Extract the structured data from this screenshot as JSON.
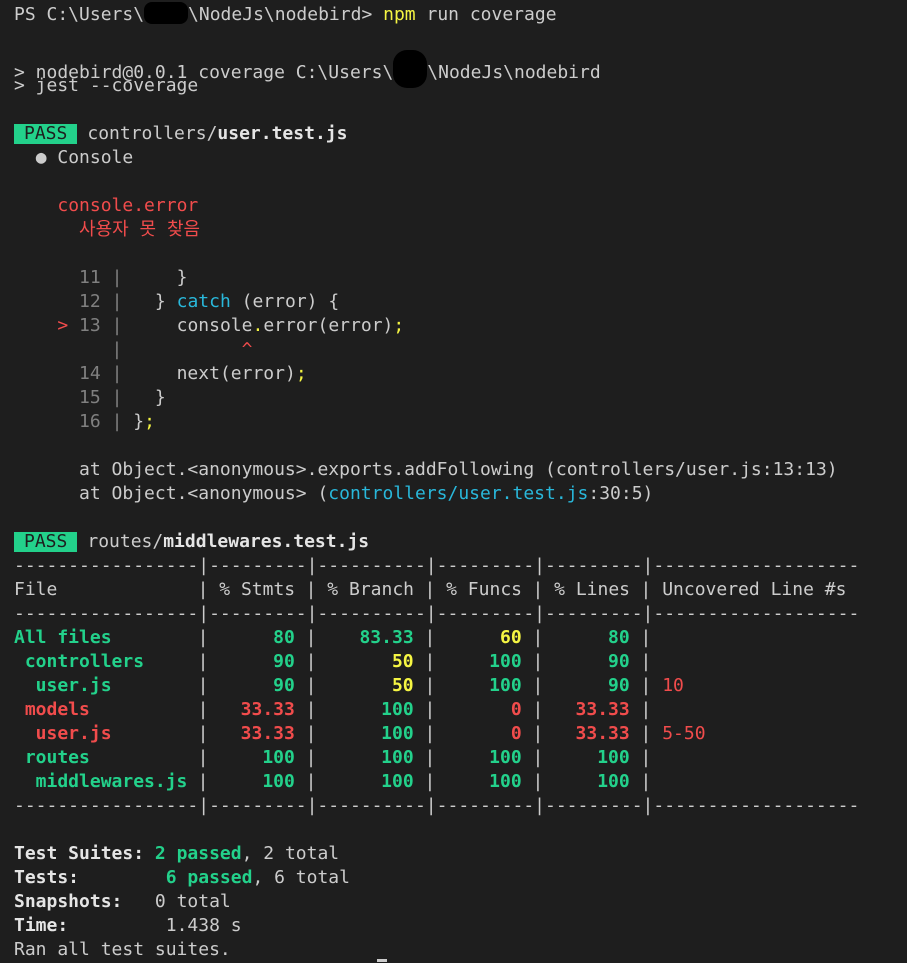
{
  "prompt": {
    "ps_prefix": "PS C:\\Users\\",
    "ps_suffix": "\\NodeJs\\nodebird>",
    "cmd": "npm",
    "cmd_args": "run coverage"
  },
  "script_lines": {
    "line1_prefix": "> nodebird@0.0.1 coverage C:\\Users\\",
    "line1_suffix": "\\NodeJs\\nodebird",
    "line2": "> jest --coverage"
  },
  "suite1": {
    "badge": "PASS",
    "path_dir": "controllers/",
    "path_file": "user.test.js"
  },
  "console": {
    "bullet": "● Console",
    "label": "console.error",
    "message": "사용자 못 찾음"
  },
  "code": {
    "l11": {
      "num": "11",
      "code": "    }"
    },
    "l12": {
      "num": "12",
      "pre": "  } ",
      "kw": "catch",
      "post": " (error) {"
    },
    "l13": {
      "marker": ">",
      "num": "13",
      "pre": "    console",
      "dot": ".",
      "fn": "error(error)",
      "semi": ";"
    },
    "caret": "^",
    "l14": {
      "num": "14",
      "pre": "    next(error)",
      "semi": ";"
    },
    "l15": {
      "num": "15",
      "code": "  }"
    },
    "l16": {
      "num": "16",
      "pre": "}",
      "semi": ";"
    }
  },
  "stack": {
    "line1": "at Object.<anonymous>.exports.addFollowing (controllers/user.js:13:13)",
    "line2_pre": "at Object.<anonymous> (",
    "line2_link": "controllers/user.test.js",
    "line2_post": ":30:5)"
  },
  "suite2": {
    "badge": "PASS",
    "path_dir": "routes/",
    "path_file": "middlewares.test.js"
  },
  "coverage": {
    "separator": "-----------------|---------|----------|---------|---------|-------------------",
    "headers": [
      "File",
      "% Stmts",
      "% Branch",
      "% Funcs",
      "% Lines",
      "Uncovered Line #s"
    ],
    "rows": [
      {
        "file": "All files",
        "stmts": "80",
        "branch": "83.33",
        "funcs": "60",
        "lines": "80",
        "uncovered": ""
      },
      {
        "file": " controllers",
        "stmts": "90",
        "branch": "50",
        "funcs": "100",
        "lines": "90",
        "uncovered": ""
      },
      {
        "file": "  user.js",
        "stmts": "90",
        "branch": "50",
        "funcs": "100",
        "lines": "90",
        "uncovered": "10"
      },
      {
        "file": " models",
        "stmts": "33.33",
        "branch": "100",
        "funcs": "0",
        "lines": "33.33",
        "uncovered": ""
      },
      {
        "file": "  user.js",
        "stmts": "33.33",
        "branch": "100",
        "funcs": "0",
        "lines": "33.33",
        "uncovered": "5-50"
      },
      {
        "file": " routes",
        "stmts": "100",
        "branch": "100",
        "funcs": "100",
        "lines": "100",
        "uncovered": ""
      },
      {
        "file": "  middlewares.js",
        "stmts": "100",
        "branch": "100",
        "funcs": "100",
        "lines": "100",
        "uncovered": ""
      }
    ]
  },
  "summary": {
    "suites_label": "Test Suites:",
    "suites_passed": "2 passed",
    "suites_total": ", 2 total",
    "tests_label": "Tests:",
    "tests_passed": "6 passed",
    "tests_total": ", 6 total",
    "snapshots_label": "Snapshots:",
    "snapshots_value": "0 total",
    "time_label": "Time:",
    "time_value": "1.438 s",
    "footer": "Ran all test suites."
  },
  "colors": {
    "bg": "#1e1e1e",
    "fg": "#cccccc",
    "green": "#23d18b",
    "yellow": "#f5f543",
    "red": "#f14c4c",
    "cyan": "#29b8db"
  }
}
